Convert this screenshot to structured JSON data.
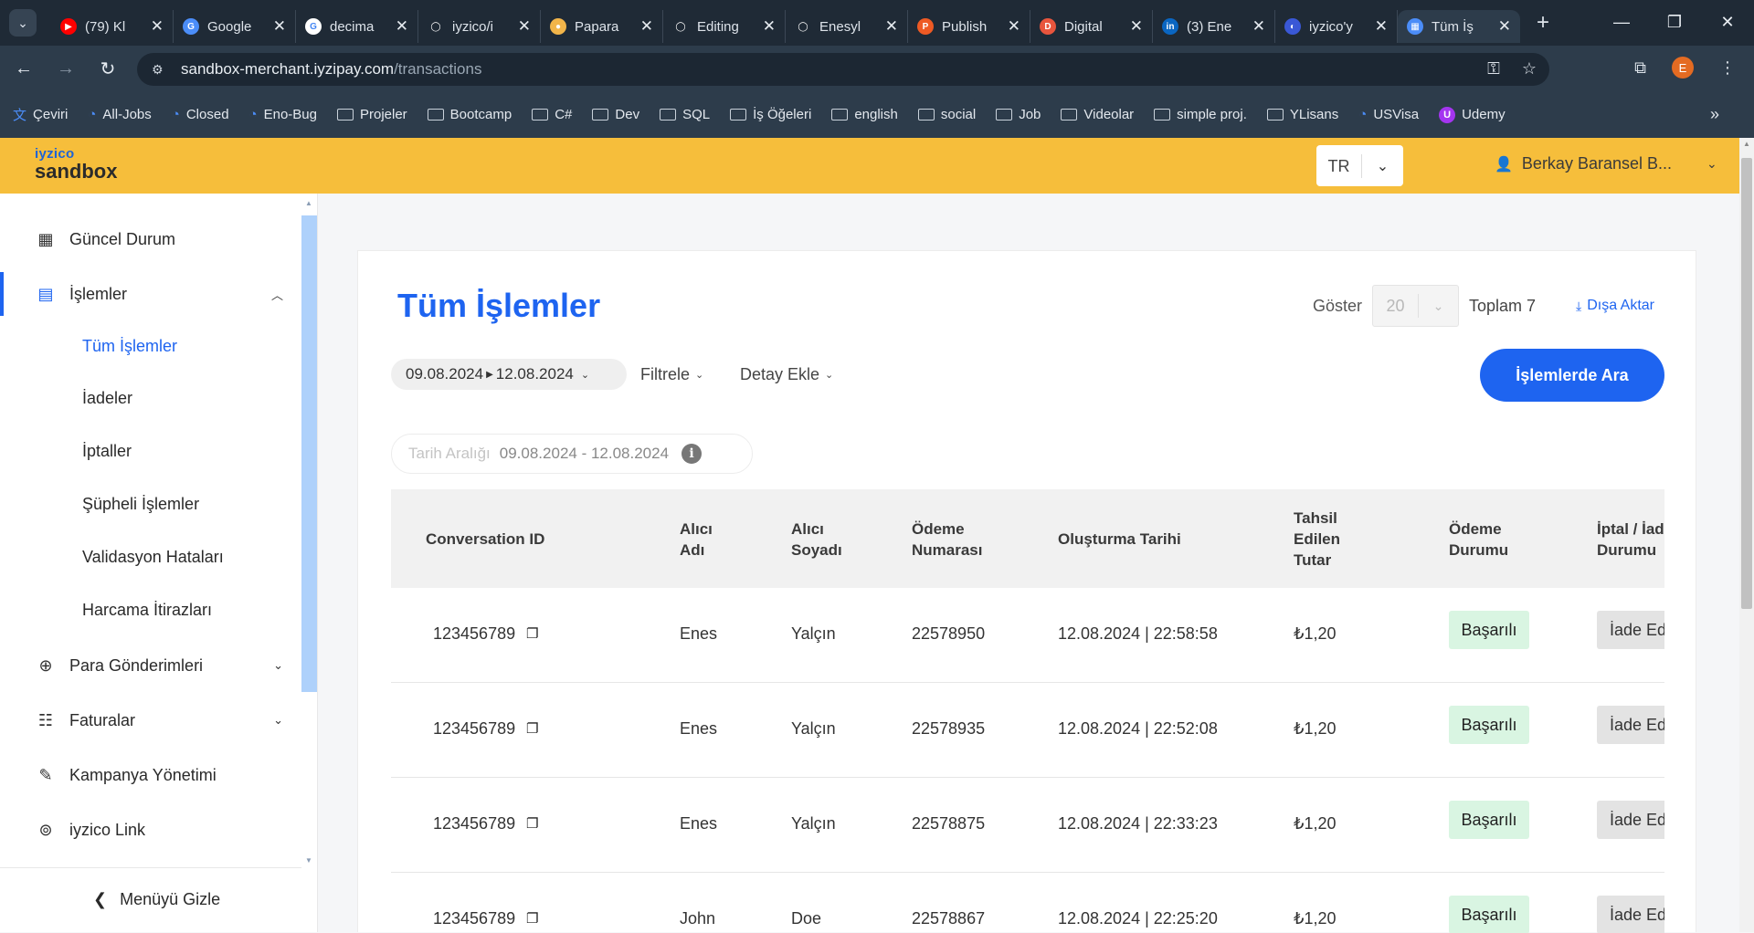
{
  "browser": {
    "tabs": [
      {
        "title": "(79) Kl",
        "fav_color": "#ff0000",
        "fav_glyph": "▶"
      },
      {
        "title": "Google",
        "fav_color": "#4b8df8",
        "fav_glyph": "G"
      },
      {
        "title": "decima",
        "fav_color": "#ffffff",
        "fav_glyph": "G"
      },
      {
        "title": "iyzico/i",
        "fav_color": "#1f2a36",
        "fav_glyph": "◯"
      },
      {
        "title": "Papara",
        "fav_color": "#f2b54a",
        "fav_glyph": "●"
      },
      {
        "title": "Editing",
        "fav_color": "#1f2a36",
        "fav_glyph": "◯"
      },
      {
        "title": "Enesyl",
        "fav_color": "#1f2a36",
        "fav_glyph": "◯"
      },
      {
        "title": "Publish",
        "fav_color": "#ee5a24",
        "fav_glyph": "P"
      },
      {
        "title": "Digital",
        "fav_color": "#e8553d",
        "fav_glyph": "D"
      },
      {
        "title": "(3) Ene",
        "fav_color": "#0a66c2",
        "fav_glyph": "in"
      },
      {
        "title": "iyzico'y",
        "fav_color": "#3a58d6",
        "fav_glyph": "◐"
      },
      {
        "title": "Tüm İş",
        "fav_color": "#4b8df8",
        "fav_glyph": "▦"
      }
    ],
    "url_host": "sandbox-merchant.iyzipay.com",
    "url_path": "/transactions",
    "profile_initial": "E",
    "bookmarks": [
      {
        "label": "Çeviri",
        "icon": "translate-icon"
      },
      {
        "label": "All-Jobs",
        "icon": "link-icon"
      },
      {
        "label": "Closed",
        "icon": "link-icon"
      },
      {
        "label": "Eno-Bug",
        "icon": "link-icon"
      },
      {
        "label": "Projeler",
        "icon": "folder-icon"
      },
      {
        "label": "Bootcamp",
        "icon": "folder-icon"
      },
      {
        "label": "C#",
        "icon": "folder-icon"
      },
      {
        "label": "Dev",
        "icon": "folder-icon"
      },
      {
        "label": "SQL",
        "icon": "folder-icon"
      },
      {
        "label": "İş Öğeleri",
        "icon": "folder-icon"
      },
      {
        "label": "english",
        "icon": "folder-icon"
      },
      {
        "label": "social",
        "icon": "folder-icon"
      },
      {
        "label": "Job",
        "icon": "folder-icon"
      },
      {
        "label": "Videolar",
        "icon": "folder-icon"
      },
      {
        "label": "simple proj.",
        "icon": "folder-icon"
      },
      {
        "label": "YLisans",
        "icon": "folder-icon"
      },
      {
        "label": "USVisa",
        "icon": "link-icon"
      },
      {
        "label": "Udemy",
        "icon": "udemy-icon"
      }
    ]
  },
  "header": {
    "logo_top": "iyzico",
    "logo_bottom": "sandbox",
    "lang": "TR",
    "user": "Berkay Baransel B..."
  },
  "sidebar": {
    "items": [
      {
        "label": "Güncel Durum"
      },
      {
        "label": "İşlemler"
      },
      {
        "label": "Para Gönderimleri"
      },
      {
        "label": "Faturalar"
      },
      {
        "label": "Kampanya Yönetimi"
      },
      {
        "label": "iyzico Link"
      }
    ],
    "subitems": [
      {
        "label": "Tüm İşlemler"
      },
      {
        "label": "İadeler"
      },
      {
        "label": "İptaller"
      },
      {
        "label": "Şüpheli İşlemler"
      },
      {
        "label": "Validasyon Hataları"
      },
      {
        "label": "Harcama İtirazları"
      }
    ],
    "hide_menu": "Menüyü Gizle"
  },
  "main": {
    "title": "Tüm İşlemler",
    "show_label": "Göster",
    "page_size": "20",
    "total": "Toplam 7",
    "export": "Dışa Aktar",
    "date_from": "09.08.2024",
    "date_to": "12.08.2024",
    "filter": "Filtrele",
    "add_detail": "Detay Ekle",
    "search_button": "İşlemlerde Ara",
    "range_label": "Tarih Aralığı",
    "range_value": "09.08.2024 - 12.08.2024",
    "columns": [
      "Conversation ID",
      "Alıcı Adı",
      "Alıcı Soyadı",
      "Ödeme Numarası",
      "Oluşturma Tarihi",
      "Tahsil Edilen Tutar",
      "Ödeme Durumu",
      "İptal / İade Durumu"
    ],
    "rows": [
      {
        "conv_id": "123456789",
        "name": "Enes",
        "surname": "Yalçın",
        "payment_no": "22578950",
        "date": "12.08.2024 | 22:58:58",
        "amount": "₺1,20",
        "status": "Başarılı",
        "refund": "İade Edilebilir"
      },
      {
        "conv_id": "123456789",
        "name": "Enes",
        "surname": "Yalçın",
        "payment_no": "22578935",
        "date": "12.08.2024 | 22:52:08",
        "amount": "₺1,20",
        "status": "Başarılı",
        "refund": "İade Edilebilir"
      },
      {
        "conv_id": "123456789",
        "name": "Enes",
        "surname": "Yalçın",
        "payment_no": "22578875",
        "date": "12.08.2024 | 22:33:23",
        "amount": "₺1,20",
        "status": "Başarılı",
        "refund": "İade Edilebilir"
      },
      {
        "conv_id": "123456789",
        "name": "John",
        "surname": "Doe",
        "payment_no": "22578867",
        "date": "12.08.2024 | 22:25:20",
        "amount": "₺1,20",
        "status": "Başarılı",
        "refund": "İade Edilebilir"
      }
    ]
  }
}
